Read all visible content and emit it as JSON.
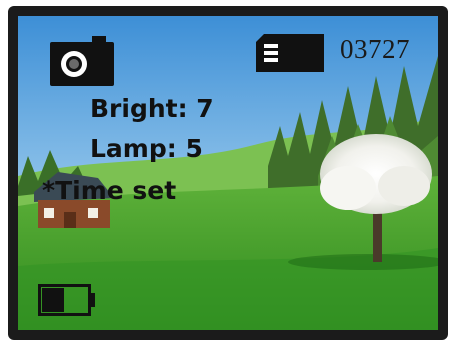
{
  "status": {
    "shot_counter": "03727",
    "battery_level": 0.5
  },
  "menu": {
    "items": [
      {
        "label": "Bright: 7",
        "selected": false
      },
      {
        "label": "Lamp: 5",
        "selected": false
      },
      {
        "label": "*Time set",
        "selected": true
      }
    ]
  },
  "icons": {
    "mode": "camera-icon",
    "storage": "sd-card-icon",
    "power": "battery-icon"
  },
  "colors": {
    "icon": "#111111",
    "text": "#111111"
  }
}
